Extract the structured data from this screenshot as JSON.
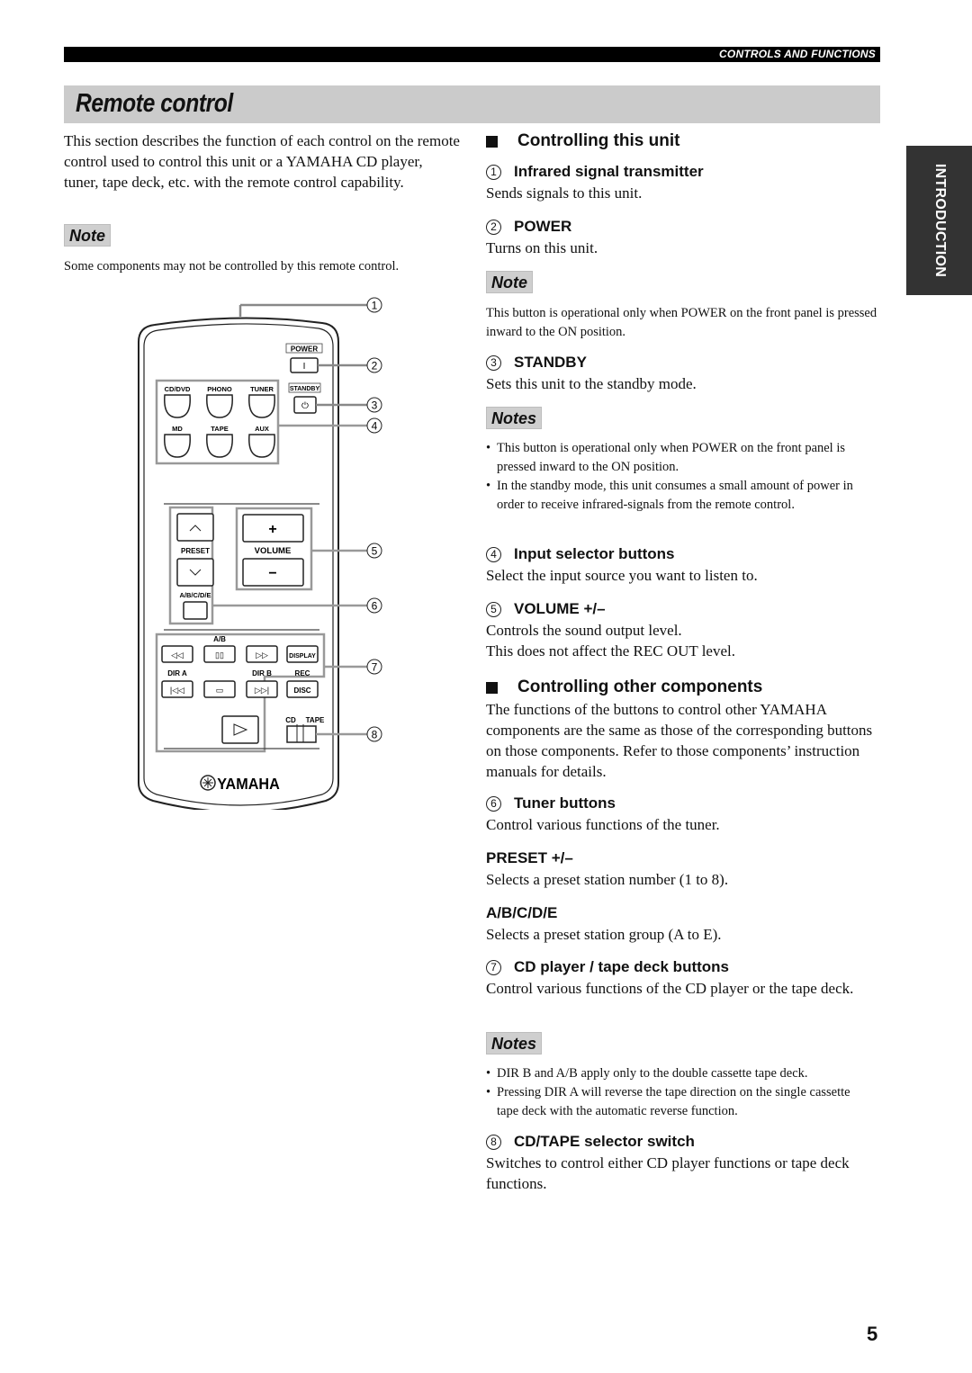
{
  "header": {
    "section": "CONTROLS AND FUNCTIONS",
    "title": "Remote control"
  },
  "side_tab": "INTRODUCTION",
  "intro": {
    "text": "This section describes the function of each control on the remote control used to control this unit or a YAMAHA CD player, tuner, tape deck, etc. with the remote control capability.",
    "note_label": "Note",
    "note_text": "Some components may not be controlled by this remote control."
  },
  "remote": {
    "callouts": [
      "1",
      "2",
      "3",
      "4",
      "5",
      "6",
      "7",
      "8"
    ],
    "power_label": "POWER",
    "power_glyph": "I",
    "standby_label": "STANDBY",
    "standby_glyph": "⏻",
    "inputs": [
      "CD/DVD",
      "PHONO",
      "TUNER",
      "MD",
      "TAPE",
      "AUX"
    ],
    "preset_label": "PRESET",
    "volume_label": "VOLUME",
    "volume_plus": "+",
    "volume_minus": "−",
    "preset_up": "⌃",
    "preset_down": "⌄",
    "abcde_label": "A/B/C/D/E",
    "ab_label": "A/B",
    "row1": [
      "◁◁",
      "▯▯",
      "▷▷",
      "DISPLAY"
    ],
    "row2_labels": [
      "DIR A",
      "",
      "DIR B",
      "REC"
    ],
    "row2": [
      "|◁◁",
      "▭",
      "▷▷|",
      "DISC"
    ],
    "play": "▷",
    "cd_label": "CD",
    "tape_label": "TAPE",
    "brand": "YAMAHA"
  },
  "right": {
    "sec1_title": "Controlling this unit",
    "items": [
      {
        "num": "1",
        "title": "Infrared signal transmitter",
        "desc": "Sends signals to this unit."
      },
      {
        "num": "2",
        "title": "POWER",
        "desc": "Turns on this unit."
      },
      {
        "num": "3",
        "title": "STANDBY",
        "desc": "Sets this unit to the standby mode."
      },
      {
        "num": "4",
        "title": "Input selector buttons",
        "desc": "Select the input source you want to listen to."
      },
      {
        "num": "5",
        "title": "VOLUME +/–",
        "desc": "Controls the sound output level.",
        "desc2": "This does not affect the REC OUT level."
      }
    ],
    "power_note_label": "Note",
    "power_note": "This button is operational only when POWER on the front panel is pressed inward to the ON position.",
    "standby_notes_label": "Notes",
    "standby_notes": [
      "This button is operational only when POWER on the front panel is pressed inward to the ON position.",
      "In the standby mode, this unit consumes a small amount of power in order to receive infrared-signals from the remote control."
    ],
    "sec2_title": "Controlling other components",
    "sec2_text": "The functions of the buttons to control other YAMAHA components are the same as those of the corresponding buttons on those components. Refer to those components’ instruction manuals for details.",
    "tuner": {
      "num": "6",
      "title": "Tuner buttons",
      "desc": "Control various functions of the tuner."
    },
    "preset": {
      "title": "PRESET +/–",
      "desc": "Selects a preset station number (1 to 8)."
    },
    "abcde": {
      "title": "A/B/C/D/E",
      "desc": "Selects a preset station group (A to E)."
    },
    "cd": {
      "num": "7",
      "title": "CD player / tape deck buttons",
      "desc": "Control various functions of the CD player or the tape deck."
    },
    "cd_notes_label": "Notes",
    "cd_notes": [
      "DIR B and A/B apply only to the double cassette tape deck.",
      "Pressing DIR A will reverse the tape direction on the single cassette tape deck with the automatic reverse function."
    ],
    "switch": {
      "num": "8",
      "title": "CD/TAPE selector switch",
      "desc": "Switches to control either CD player functions or tape deck functions."
    }
  },
  "page_number": "5"
}
